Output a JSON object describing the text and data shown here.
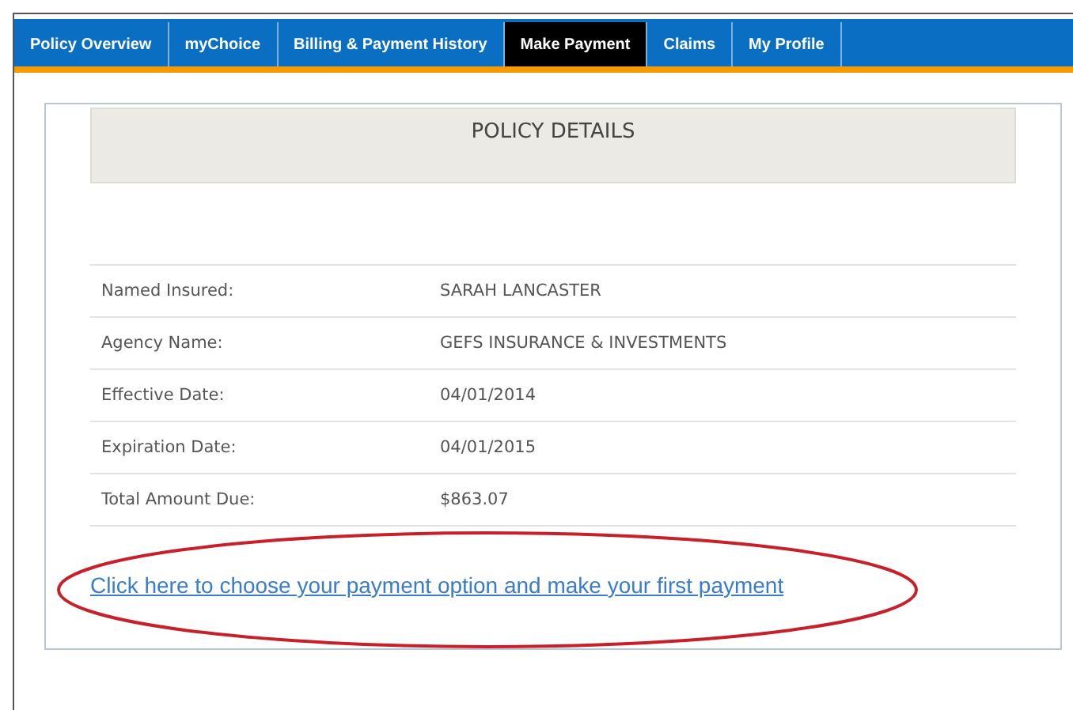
{
  "tabs": [
    {
      "label": "Policy Overview",
      "selected": false
    },
    {
      "label": "myChoice",
      "selected": false
    },
    {
      "label": "Billing & Payment History",
      "selected": false
    },
    {
      "label": "Make Payment",
      "selected": true
    },
    {
      "label": "Claims",
      "selected": false
    },
    {
      "label": "My Profile",
      "selected": false
    }
  ],
  "policy_details": {
    "title": "POLICY DETAILS",
    "rows": [
      {
        "label": "Named Insured:",
        "value": "SARAH LANCASTER"
      },
      {
        "label": "Agency Name:",
        "value": "GEFS INSURANCE & INVESTMENTS"
      },
      {
        "label": "Effective Date:",
        "value": "04/01/2014"
      },
      {
        "label": "Expiration Date:",
        "value": "04/01/2015"
      },
      {
        "label": "Total Amount Due:",
        "value": "$863.07"
      }
    ],
    "link": "Click here to choose your payment option and make your first payment"
  }
}
